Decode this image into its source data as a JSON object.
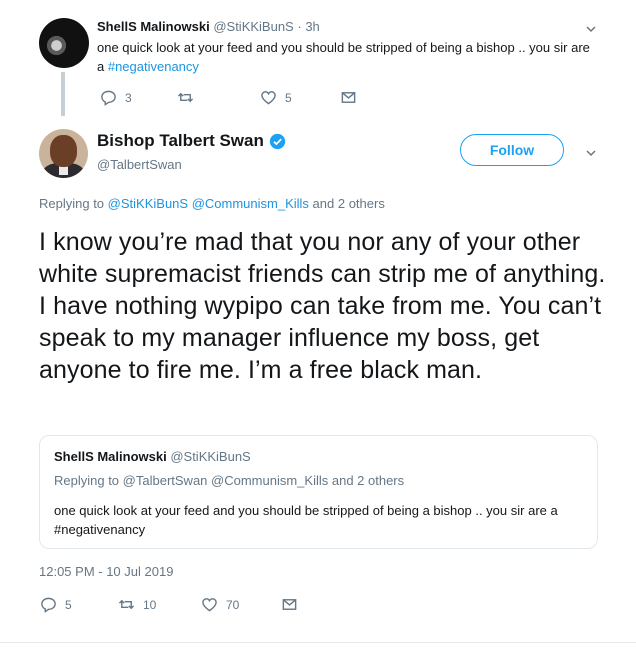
{
  "reply_tweet": {
    "display_name": "ShellS Malinowski",
    "handle": "@StiKKiBunS",
    "separator": "·",
    "time": "3h",
    "text_before_hashtag": "one quick look at your feed and you should be stripped of being a bishop .. you sir are a ",
    "hashtag": "#negativenancy",
    "reply_count": "3",
    "retweet_count": "",
    "like_count": "5"
  },
  "main_tweet": {
    "display_name": "Bishop Talbert Swan",
    "handle": "@TalbertSwan",
    "follow_label": "Follow",
    "replying_prefix": "Replying to",
    "replying_user1": "@StiKKiBunS",
    "replying_user2": "@Communism_Kills",
    "replying_suffix": "and 2 others",
    "text": "I know you’re mad that you nor any of your other white supremacist friends can strip me of anything. I have nothing wypipo can take from me. You can’t speak to my manager influence my boss, get anyone to fire me. I’m a free black man.",
    "timestamp": "12:05 PM - 10 Jul 2019",
    "reply_count": "5",
    "retweet_count": "10",
    "like_count": "70"
  },
  "quoted_tweet": {
    "display_name": "ShellS Malinowski",
    "handle": "@StiKKiBunS",
    "replying_prefix": "Replying to",
    "replying_users": "@TalbertSwan @Communism_Kills",
    "replying_suffix": "and 2 others",
    "text": "one quick look at your feed and you should be stripped of being a bishop .. you sir are a #negativenancy"
  },
  "icons": {
    "reply": "reply-icon",
    "retweet": "retweet-icon",
    "like": "heart-icon",
    "message": "envelope-icon",
    "caret": "chevron-down-icon",
    "verified": "verified-badge-icon"
  },
  "colors": {
    "link": "#1b95e0",
    "muted": "#657786",
    "follow": "#1da1f2"
  }
}
